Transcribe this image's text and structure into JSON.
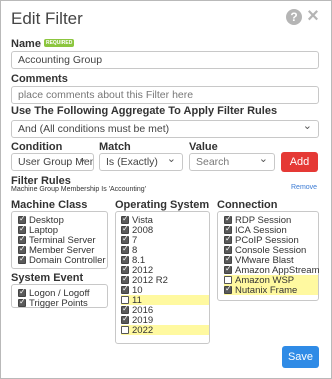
{
  "dialog": {
    "title": "Edit Filter"
  },
  "name": {
    "label": "Name",
    "badge": "REQUIRED",
    "value": "Accounting Group"
  },
  "comments": {
    "label": "Comments",
    "placeholder": "place comments about this Filter here"
  },
  "aggregate": {
    "label": "Use The Following Aggregate To Apply Filter Rules",
    "value": "And (All conditions must be met)"
  },
  "rule": {
    "condition_label": "Condition",
    "match_label": "Match",
    "value_label": "Value",
    "condition_value": "User Group Men",
    "match_value": "Is (Exactly)",
    "value_placeholder": "Search",
    "add_label": "Add"
  },
  "filter_rules": {
    "label": "Filter Rules",
    "summary": "Machine Group Membership Is 'Accounting'",
    "remove_label": "Remove"
  },
  "machine_class": {
    "label": "Machine Class",
    "items": [
      {
        "label": "Desktop",
        "checked": true
      },
      {
        "label": "Laptop",
        "checked": true
      },
      {
        "label": "Terminal Server",
        "checked": true
      },
      {
        "label": "Member Server",
        "checked": true
      },
      {
        "label": "Domain Controller",
        "checked": true
      }
    ]
  },
  "system_event": {
    "label": "System Event",
    "items": [
      {
        "label": "Logon / Logoff",
        "checked": true
      },
      {
        "label": "Trigger Points",
        "checked": true
      }
    ]
  },
  "operating_system": {
    "label": "Operating System",
    "items": [
      {
        "label": "Vista",
        "checked": true
      },
      {
        "label": "2008",
        "checked": true
      },
      {
        "label": "7",
        "checked": true
      },
      {
        "label": "8",
        "checked": true
      },
      {
        "label": "8.1",
        "checked": true
      },
      {
        "label": "2012",
        "checked": true
      },
      {
        "label": "2012 R2",
        "checked": true
      },
      {
        "label": "10",
        "checked": true
      },
      {
        "label": "11",
        "checked": false,
        "highlight": true
      },
      {
        "label": "2016",
        "checked": true
      },
      {
        "label": "2019",
        "checked": true
      },
      {
        "label": "2022",
        "checked": false,
        "highlight": true
      }
    ]
  },
  "connection": {
    "label": "Connection",
    "items": [
      {
        "label": "RDP Session",
        "checked": true
      },
      {
        "label": "ICA Session",
        "checked": true
      },
      {
        "label": "PCoIP Session",
        "checked": true
      },
      {
        "label": "Console Session",
        "checked": true
      },
      {
        "label": "VMware Blast",
        "checked": true
      },
      {
        "label": "Amazon AppStream",
        "checked": true
      },
      {
        "label": "Amazon WSP",
        "checked": false,
        "highlight": true
      },
      {
        "label": "Nutanix Frame",
        "checked": true,
        "highlight": true
      }
    ]
  },
  "footer": {
    "save_label": "Save"
  },
  "colors": {
    "add": "#e53935",
    "save": "#2f8be6",
    "highlight": "#fff9a0",
    "badge": "#8cc63f",
    "link": "#3b7bd4"
  }
}
